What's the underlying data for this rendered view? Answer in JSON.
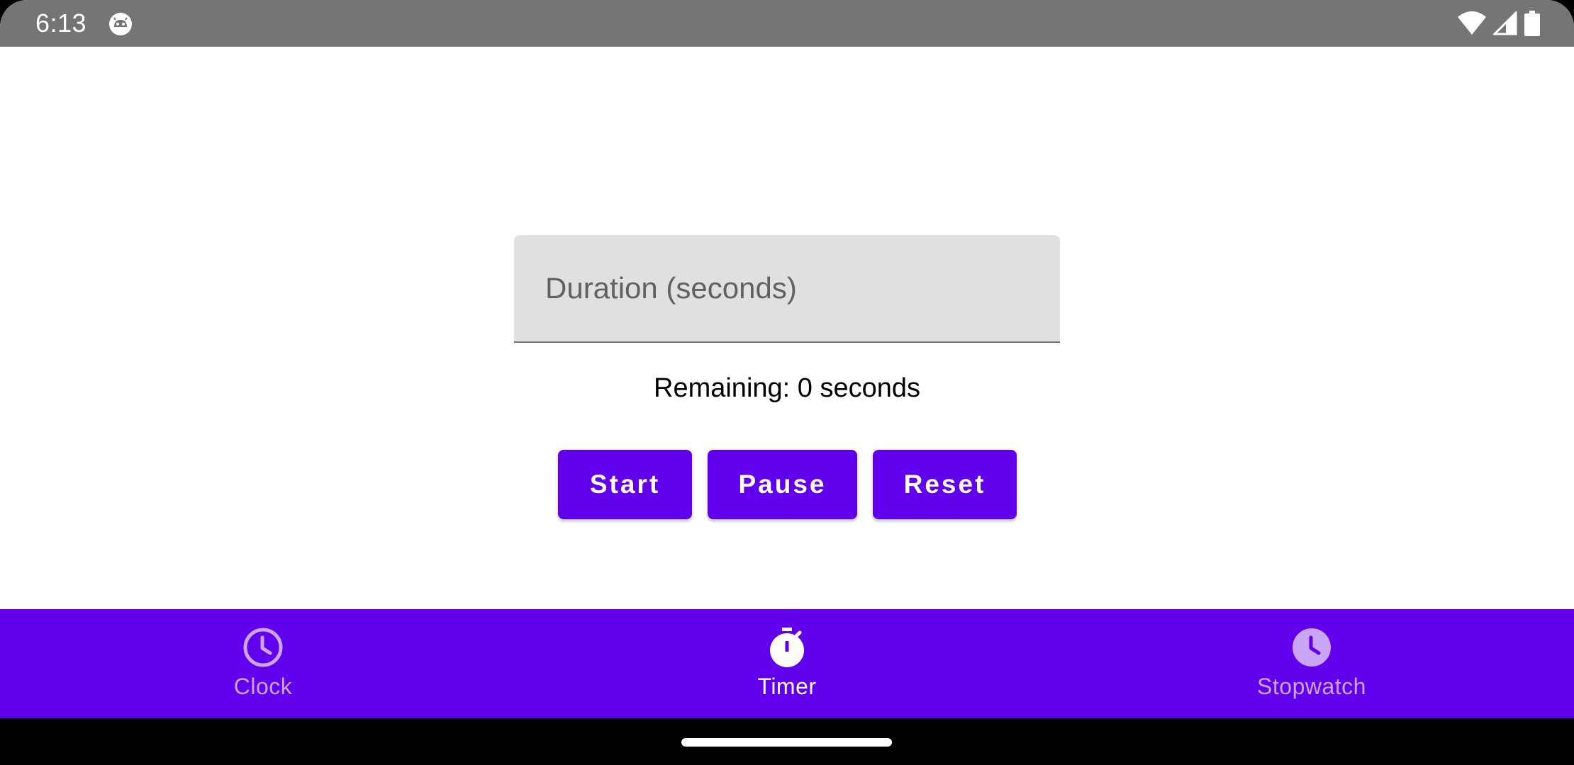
{
  "status_bar": {
    "time": "6:13",
    "app_icon": "android-face-icon",
    "wifi_icon": "wifi-icon",
    "signal_icon": "cell-signal-icon",
    "battery_icon": "battery-icon"
  },
  "timer": {
    "duration_placeholder": "Duration (seconds)",
    "duration_value": "",
    "remaining_text": "Remaining: 0 seconds",
    "buttons": {
      "start": "Start",
      "pause": "Pause",
      "reset": "Reset"
    }
  },
  "bottom_nav": {
    "items": [
      {
        "label": "Clock",
        "icon": "clock-icon",
        "active": false
      },
      {
        "label": "Timer",
        "icon": "timer-icon",
        "active": true
      },
      {
        "label": "Stopwatch",
        "icon": "stopwatch-icon",
        "active": false
      }
    ]
  },
  "colors": {
    "primary": "#6200ee",
    "status_bar": "#757575",
    "field_background": "#e0e0e0",
    "nav_inactive": "#c9a6f7",
    "nav_active": "#ffffff"
  }
}
